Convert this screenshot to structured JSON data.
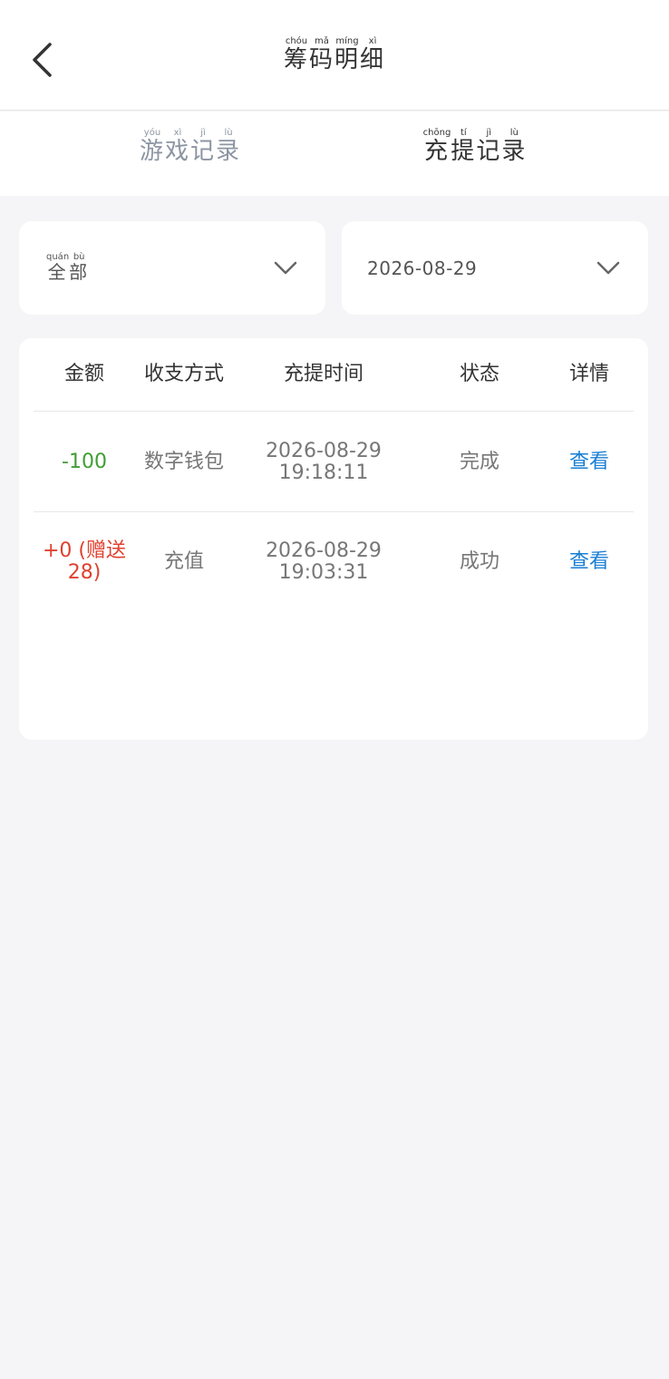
{
  "header": {
    "title_chars": [
      {
        "char": "筹",
        "pinyin": "chóu"
      },
      {
        "char": "码",
        "pinyin": "mǎ"
      },
      {
        "char": "明",
        "pinyin": "míng"
      },
      {
        "char": "细",
        "pinyin": "xì"
      }
    ]
  },
  "tabs": [
    {
      "chars": [
        {
          "char": "游",
          "pinyin": "yóu"
        },
        {
          "char": "戏",
          "pinyin": "xì"
        },
        {
          "char": "记",
          "pinyin": "jì"
        },
        {
          "char": "录",
          "pinyin": "lù"
        }
      ]
    },
    {
      "chars": [
        {
          "char": "充",
          "pinyin": "chōng"
        },
        {
          "char": "提",
          "pinyin": "tí"
        },
        {
          "char": "记",
          "pinyin": "jì"
        },
        {
          "char": "录",
          "pinyin": "lù"
        }
      ]
    }
  ],
  "filters": {
    "type_chars": [
      {
        "char": "全",
        "pinyin": "quán"
      },
      {
        "char": "部",
        "pinyin": "bù"
      }
    ],
    "date": "2026-08-29"
  },
  "table": {
    "headers": {
      "amount": "金额",
      "method": "收支方式",
      "time": "充提时间",
      "status": "状态",
      "detail": "详情"
    },
    "rows": [
      {
        "amount": "-100",
        "method": "数字钱包",
        "date": "2026-08-29",
        "clock": "19:18:11",
        "status": "完成",
        "detail": "查看"
      },
      {
        "amount": "+0 (赠送28)",
        "method": "充值",
        "date": "2026-08-29",
        "clock": "19:03:31",
        "status": "成功",
        "detail": "查看"
      }
    ]
  },
  "colors": {
    "negative_amount": "#3f9e33",
    "positive_amount": "#e0402f",
    "link": "#1a7fd4",
    "inactive_tab": "#8c95a3"
  }
}
